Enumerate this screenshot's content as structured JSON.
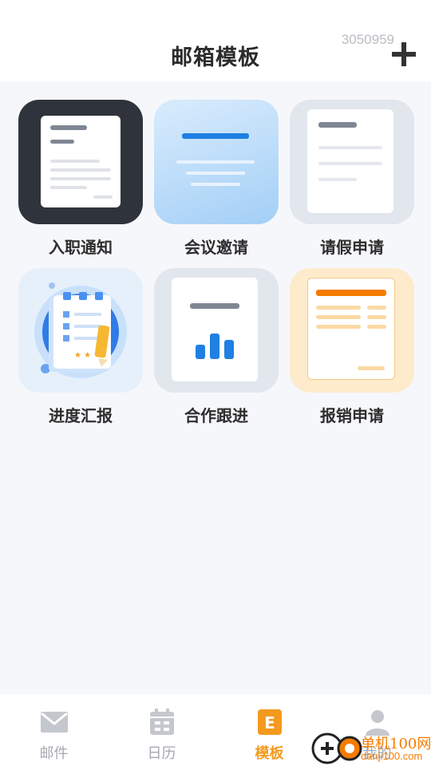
{
  "header": {
    "title": "邮箱模板",
    "code": "3050959"
  },
  "templates": [
    {
      "label": "入职通知",
      "icon": "document-icon",
      "bg": "#2f343c"
    },
    {
      "label": "会议邀请",
      "icon": "meeting-icon",
      "bg": "#9fcdf7"
    },
    {
      "label": "请假申请",
      "icon": "leave-doc-icon",
      "bg": "#e3e7ee"
    },
    {
      "label": "进度汇报",
      "icon": "progress-report-icon",
      "bg": "#e7f1fb"
    },
    {
      "label": "合作跟进",
      "icon": "chart-doc-icon",
      "bg": "#e3e7ee"
    },
    {
      "label": "报销申请",
      "icon": "reimburse-doc-icon",
      "bg": "#fdebcc"
    }
  ],
  "tabs": [
    {
      "label": "邮件",
      "icon": "mail-icon",
      "active": false
    },
    {
      "label": "日历",
      "icon": "calendar-icon",
      "active": false
    },
    {
      "label": "模板",
      "icon": "template-icon",
      "active": true
    },
    {
      "label": "我的",
      "icon": "user-icon",
      "active": false
    }
  ],
  "watermark": {
    "text": "单机100网",
    "url": "danji100.com"
  },
  "colors": {
    "accent": "#f39a1f",
    "blue": "#1f7fe3",
    "orange": "#f57c00"
  }
}
